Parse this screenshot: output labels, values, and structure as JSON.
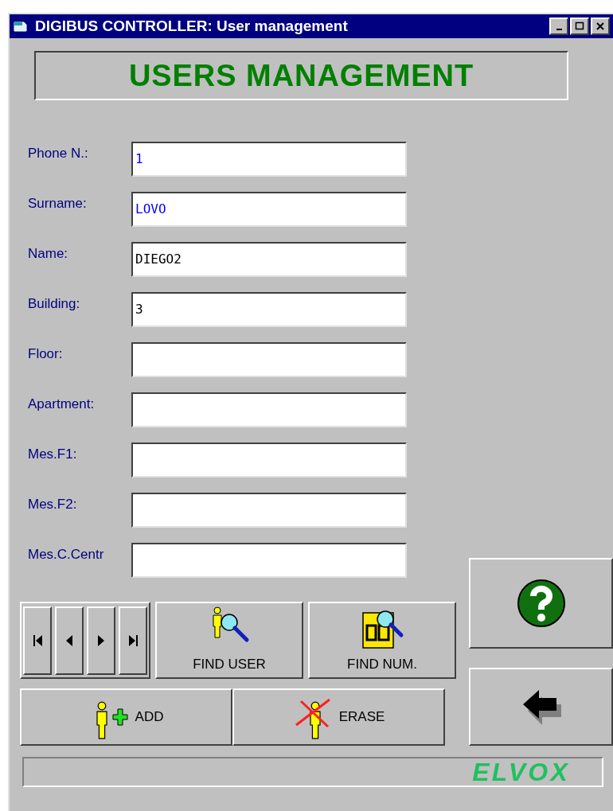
{
  "window": {
    "title": "DIGIBUS CONTROLLER: User management",
    "controls": [
      {
        "kind": "minimize"
      },
      {
        "kind": "maximize"
      },
      {
        "kind": "close"
      }
    ]
  },
  "heading": "USERS MANAGEMENT",
  "fields": [
    {
      "label": "Phone N.:",
      "value": "1",
      "color": "#0000ff"
    },
    {
      "label": "Surname:",
      "value": "LOVO",
      "color": "#0000ff"
    },
    {
      "label": "Name:",
      "value": "DIEGO2",
      "color": "#000000"
    },
    {
      "label": "Building:",
      "value": "3",
      "color": "#000000"
    },
    {
      "label": "Floor:"
    },
    {
      "label": "Apartment:"
    },
    {
      "label": "Mes.F1:"
    },
    {
      "label": "Mes.F2:"
    },
    {
      "label": "Mes.C.Centr"
    }
  ],
  "navigation": [
    {
      "kind": "first"
    },
    {
      "kind": "previous"
    },
    {
      "kind": "next"
    },
    {
      "kind": "last"
    }
  ],
  "search_buttons": [
    {
      "label": "FIND USER",
      "kind": "find-user"
    },
    {
      "label": "FIND NUM.",
      "kind": "find-number"
    }
  ],
  "action_buttons": [
    {
      "label": "ADD",
      "kind": "add"
    },
    {
      "label": "ERASE",
      "kind": "erase"
    }
  ],
  "side_buttons": [
    {
      "kind": "help"
    },
    {
      "kind": "back"
    }
  ],
  "status_bar": {
    "logo": "ELVOX"
  }
}
